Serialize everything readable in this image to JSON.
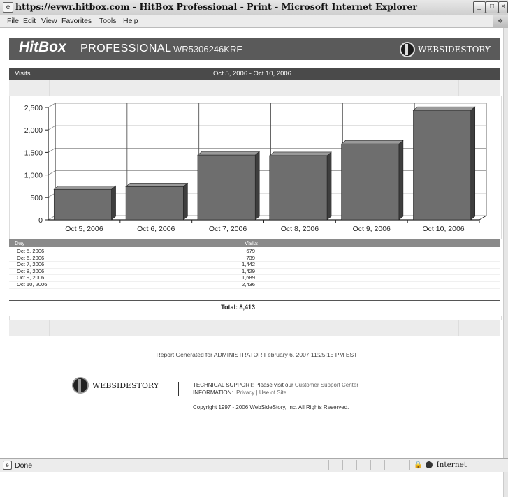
{
  "browser": {
    "title": "https://evwr.hitbox.com - HitBox Professional - Print - Microsoft Internet Explorer",
    "menu": [
      "File",
      "Edit",
      "View",
      "Favorites",
      "Tools",
      "Help"
    ],
    "status": "Done",
    "zone": "Internet"
  },
  "header": {
    "brand_hitbox": "HitBox",
    "brand_pro": "PROFESSIONAL",
    "account_id": "WR5306246KRE",
    "partner": "WEBSIDESTORY"
  },
  "report": {
    "metric": "Visits",
    "date_range": "Oct 5, 2006 - Oct 10, 2006"
  },
  "chart_data": {
    "type": "bar",
    "categories": [
      "Oct 5, 2006",
      "Oct 6, 2006",
      "Oct 7, 2006",
      "Oct 8, 2006",
      "Oct 9, 2006",
      "Oct 10, 2006"
    ],
    "values": [
      679,
      739,
      1442,
      1429,
      1689,
      2436
    ],
    "yticks": [
      "2,500",
      "2,000",
      "1,500",
      "1,000",
      "500",
      "0"
    ],
    "ylim": [
      0,
      2500
    ],
    "grid": true,
    "bar_color": "#6e6e6e"
  },
  "table": {
    "headers": {
      "day": "Day",
      "visits": "Visits"
    },
    "rows": [
      {
        "day": "Oct 5, 2006",
        "visits": "679"
      },
      {
        "day": "Oct 6, 2006",
        "visits": "739"
      },
      {
        "day": "Oct 7, 2006",
        "visits": "1,442"
      },
      {
        "day": "Oct 8, 2006",
        "visits": "1,429"
      },
      {
        "day": "Oct 9, 2006",
        "visits": "1,689"
      },
      {
        "day": "Oct 10, 2006",
        "visits": "2,436"
      }
    ],
    "total": "Total: 8,413"
  },
  "footer": {
    "generated": "Report Generated for ADMINISTRATOR  February 6, 2007 11:25:15 PM EST",
    "logo": "WEBSIDESTORY",
    "support_label": "TECHNICAL SUPPORT:",
    "support_text": "Please visit our",
    "support_link": "Customer Support Center",
    "info_label": "INFORMATION:",
    "privacy_link": "Privacy",
    "use_link": "Use of Site",
    "copyright": "Copyright 1997 - 2006 WebSideStory, Inc. All Rights Reserved."
  }
}
